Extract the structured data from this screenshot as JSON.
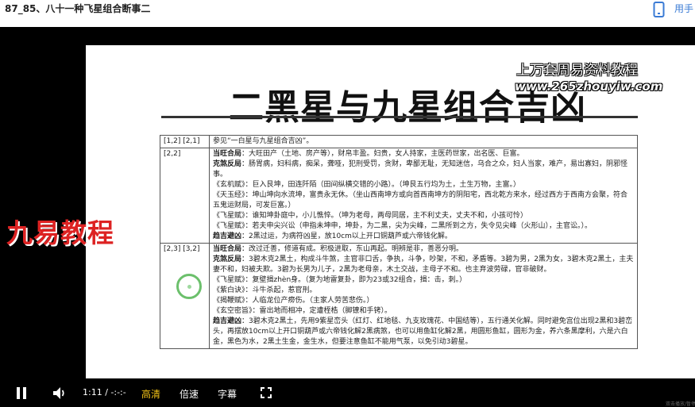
{
  "page": {
    "title": "87_85、八十一种飞星组合断事二",
    "phone_label": "用手"
  },
  "watermarks": {
    "top_line1": "上万套周易资料教程",
    "top_line2": "www.265zhouyiw.com",
    "left": "九易教程"
  },
  "slide": {
    "heading": "二黑星与九星组合吉凶",
    "rows": [
      {
        "code": "[1,2] [2,1]",
        "lines": [
          {
            "kw": "",
            "text": "参见“一白星与九星组合吉凶”。"
          }
        ]
      },
      {
        "code": "[2,2]",
        "lines": [
          {
            "kw": "当旺合局",
            "text": "：大旺田产（土地、房产等），财帛丰盈。妇贵，女人持家，主医药世家，出名医、巨富。"
          },
          {
            "kw": "克煞反局",
            "text": "：肠胃病，妇科病，痴呆，聋哑，犯刑受罚，贪财，卑鄙无耻，无知迷信，乌合之众，妇人当家，难产，易出寡妇，阴邪怪事。"
          },
          {
            "kw": "",
            "text": "《玄机赋》：巨入艮坤，田连阡陌（田间纵横交错的小路）。（坤艮五行均为土，土生万物，主富。）"
          },
          {
            "kw": "",
            "text": "《天玉经》：坤山坤向水流坤，富贵永无休。（坐山西南坤方或向首西南坤方的阴阳宅，西北乾方来水，经过西方于西南方会聚，符合五鬼运财局，可发巨富。）"
          },
          {
            "kw": "",
            "text": "《飞星赋》：谁知坤卦庭中，小儿憔悴。（坤为老母，两母同居，主不利丈夫，丈夫不和，小孩可怜）"
          },
          {
            "kw": "",
            "text": "《飞星赋》：若夫申尖兴讼（申指未坤申，坤卦，为二黑，尖为尖峰，二黑所到之方，失令见尖峰（火形山），主官讼。）。"
          },
          {
            "kw": "趋吉避凶",
            "text": "：2黑过运，为病符凶星，放10cm以上开口铜葫芦或六帝钱化解。"
          }
        ]
      },
      {
        "code": "[2,3] [3,2]",
        "lines": [
          {
            "kw": "当旺合局",
            "text": "：改过迁善，修道有成。积极进取，东山再起。明辨是非，善恶分明。"
          },
          {
            "kw": "克煞反局",
            "text": "：3碧木克2黑土，构成斗牛煞，主官非口舌，争执，斗争，吵架，不和，矛盾等。3碧为男，2黑为女，3碧木克2黑土，主夫妻不和，妇被夫欺。3碧为长男为儿子，2黑为老母亲，木土交战，主母子不和。也主弃波劳碌，官非破财。"
          },
          {
            "kw": "",
            "text": "《飞星赋》：复壁揖zhèn身。（复为地雷复卦，即为23或32组合，揖：击，刺。）"
          },
          {
            "kw": "",
            "text": "《紫白诀》：斗牛杀起，惹官刑。"
          },
          {
            "kw": "",
            "text": "《揭鞭赋》：人临龙位产痨伤。（主家人劳苦悲伤。）"
          },
          {
            "kw": "",
            "text": "《玄空密旨》：雷出地而相冲，定遭桎梏（脚镣和手铐）。"
          },
          {
            "kw": "趋吉避凶",
            "text": "：3碧木克2黑土，先用9紫星峦头（红灯、红地毯、九支玫瑰花、中国结等），五行通关化解。同时避免宫位出现2黑和3碧峦头，再摆放10cm以上开口铜葫芦或六帝钱化解2黑病煞，也可以用鱼缸化解2黑，用圆形鱼缸，圆形为金，养六条黑摩利，六是六白金，黑色为水，2黑土生金，金生水，但要注意鱼缸不能用气泵，以免引动3碧星。"
          }
        ]
      }
    ]
  },
  "controls": {
    "time": "1:11 / -:-:-",
    "quality": "高清",
    "speed": "倍速",
    "subtitles": "字幕",
    "quality_color": "#f5c518",
    "hint": "双击播放/暂停"
  },
  "icons": [
    "phone-icon",
    "pause-icon",
    "volume-icon",
    "fullscreen-icon"
  ]
}
